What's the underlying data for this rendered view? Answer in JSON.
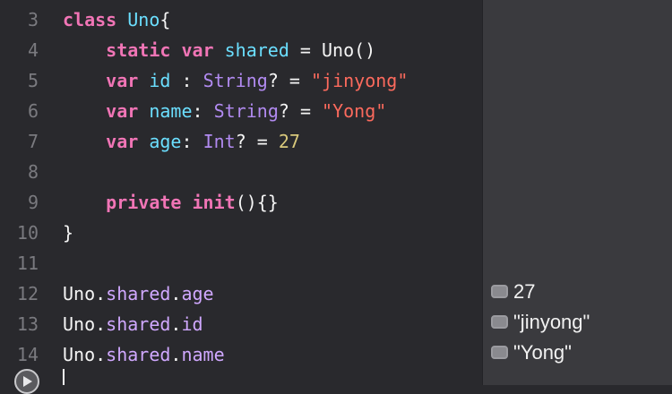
{
  "lines": [
    {
      "num": "3",
      "tokens": [
        [
          "kw",
          "class"
        ],
        [
          "pl",
          " "
        ],
        [
          "ty",
          "Uno"
        ],
        [
          "pl",
          "{"
        ]
      ]
    },
    {
      "num": "4",
      "tokens": [
        [
          "pl",
          "    "
        ],
        [
          "kw",
          "static"
        ],
        [
          "pl",
          " "
        ],
        [
          "kw",
          "var"
        ],
        [
          "pl",
          " "
        ],
        [
          "ty",
          "shared"
        ],
        [
          "pl",
          " = Uno()"
        ]
      ]
    },
    {
      "num": "5",
      "tokens": [
        [
          "pl",
          "    "
        ],
        [
          "kw",
          "var"
        ],
        [
          "pl",
          " "
        ],
        [
          "ty",
          "id"
        ],
        [
          "pl",
          " : "
        ],
        [
          "fn",
          "String"
        ],
        [
          "pl",
          "? = "
        ],
        [
          "st",
          "\"jinyong\""
        ]
      ]
    },
    {
      "num": "6",
      "tokens": [
        [
          "pl",
          "    "
        ],
        [
          "kw",
          "var"
        ],
        [
          "pl",
          " "
        ],
        [
          "ty",
          "name"
        ],
        [
          "pl",
          ": "
        ],
        [
          "fn",
          "String"
        ],
        [
          "pl",
          "? = "
        ],
        [
          "st",
          "\"Yong\""
        ]
      ]
    },
    {
      "num": "7",
      "tokens": [
        [
          "pl",
          "    "
        ],
        [
          "kw",
          "var"
        ],
        [
          "pl",
          " "
        ],
        [
          "ty",
          "age"
        ],
        [
          "pl",
          ": "
        ],
        [
          "fn",
          "Int"
        ],
        [
          "pl",
          "? = "
        ],
        [
          "nu",
          "27"
        ]
      ]
    },
    {
      "num": "8",
      "tokens": []
    },
    {
      "num": "9",
      "tokens": [
        [
          "pl",
          "    "
        ],
        [
          "kw",
          "private"
        ],
        [
          "pl",
          " "
        ],
        [
          "kw",
          "init"
        ],
        [
          "pl",
          "(){}"
        ]
      ]
    },
    {
      "num": "10",
      "tokens": [
        [
          "pl",
          "}"
        ]
      ]
    },
    {
      "num": "11",
      "tokens": []
    },
    {
      "num": "12",
      "tokens": [
        [
          "pl",
          "Uno."
        ],
        [
          "cls",
          "shared"
        ],
        [
          "pl",
          "."
        ],
        [
          "cls",
          "age"
        ]
      ]
    },
    {
      "num": "13",
      "tokens": [
        [
          "pl",
          "Uno."
        ],
        [
          "cls",
          "shared"
        ],
        [
          "pl",
          "."
        ],
        [
          "cls",
          "id"
        ]
      ]
    },
    {
      "num": "14",
      "tokens": [
        [
          "pl",
          "Uno."
        ],
        [
          "cls",
          "shared"
        ],
        [
          "pl",
          "."
        ],
        [
          "cls",
          "name"
        ]
      ]
    }
  ],
  "results": [
    "27",
    "\"jinyong\"",
    "\"Yong\""
  ],
  "icons": {
    "run": "play-icon",
    "result": "quick-look-icon"
  }
}
